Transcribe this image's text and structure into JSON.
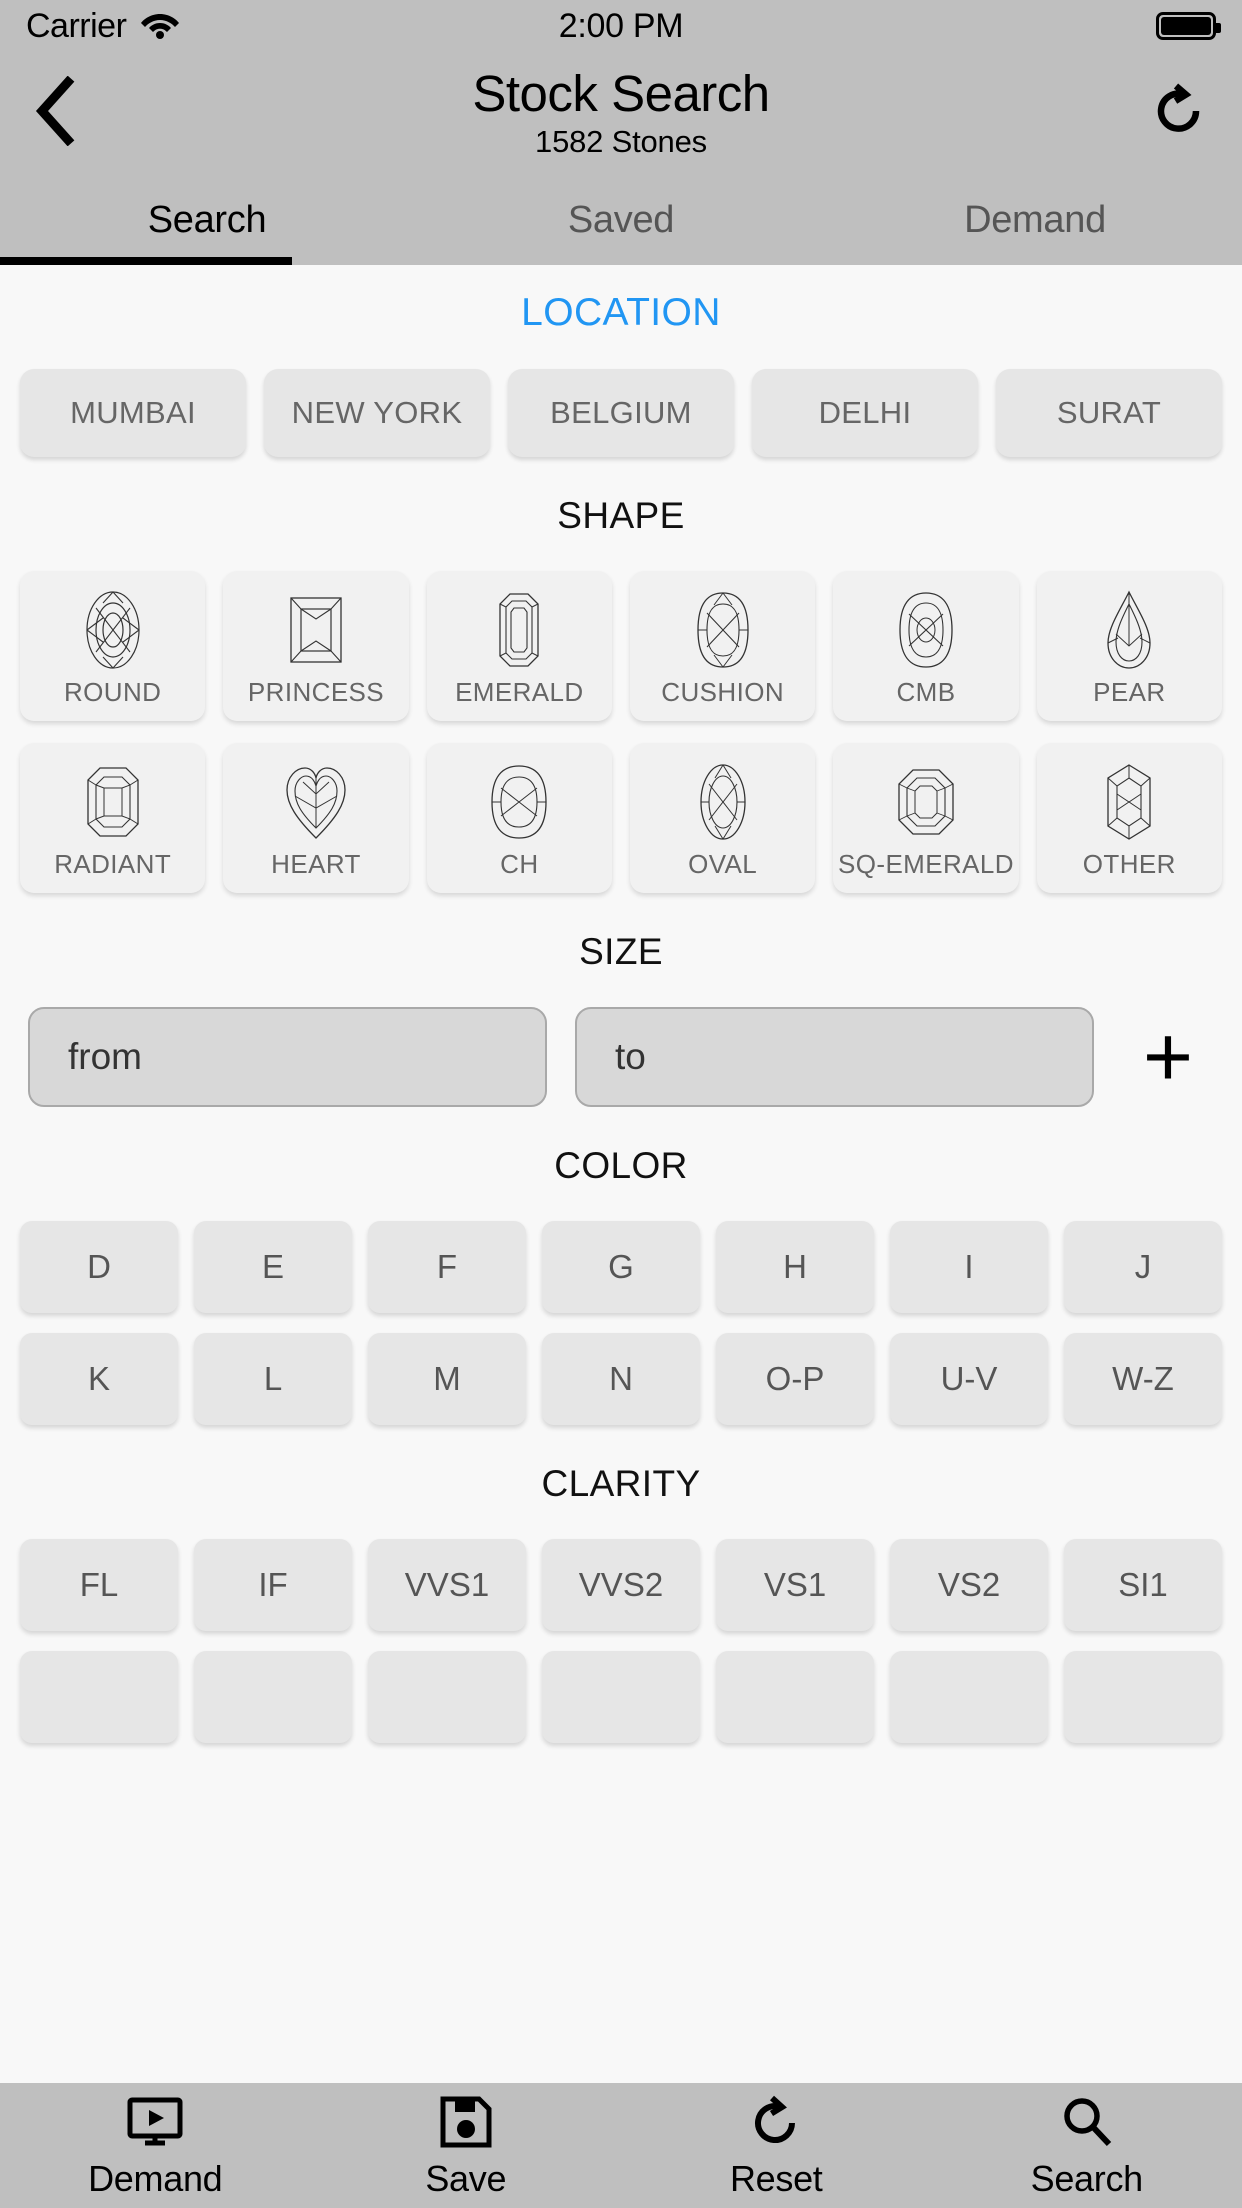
{
  "status_bar": {
    "carrier": "Carrier",
    "wifi_icon": "wifi-icon",
    "time": "2:00 PM",
    "battery_icon": "battery-full-icon"
  },
  "nav_bar": {
    "back_icon": "chevron-left-icon",
    "title": "Stock Search",
    "subtitle": "1582 Stones",
    "refresh_icon": "refresh-icon"
  },
  "tabs": {
    "items": [
      {
        "label": "Search",
        "active": true
      },
      {
        "label": "Saved",
        "active": false
      },
      {
        "label": "Demand",
        "active": false
      }
    ]
  },
  "sections": {
    "location": {
      "title": "LOCATION",
      "accent_color": "#2196f3",
      "options": [
        "MUMBAI",
        "NEW YORK",
        "BELGIUM",
        "DELHI",
        "SURAT"
      ]
    },
    "shape": {
      "title": "SHAPE",
      "rows": [
        [
          {
            "label": "ROUND",
            "icon": "diamond-round-icon"
          },
          {
            "label": "PRINCESS",
            "icon": "diamond-princess-icon"
          },
          {
            "label": "EMERALD",
            "icon": "diamond-emerald-icon"
          },
          {
            "label": "CUSHION",
            "icon": "diamond-cushion-icon"
          },
          {
            "label": "CMB",
            "icon": "diamond-cmb-icon"
          },
          {
            "label": "PEAR",
            "icon": "diamond-pear-icon"
          }
        ],
        [
          {
            "label": "RADIANT",
            "icon": "diamond-radiant-icon"
          },
          {
            "label": "HEART",
            "icon": "diamond-heart-icon"
          },
          {
            "label": "CH",
            "icon": "diamond-ch-icon"
          },
          {
            "label": "OVAL",
            "icon": "diamond-oval-icon"
          },
          {
            "label": "SQ-EMERALD",
            "icon": "diamond-sq-emerald-icon"
          },
          {
            "label": "OTHER",
            "icon": "diamond-other-icon"
          }
        ]
      ]
    },
    "size": {
      "title": "SIZE",
      "from_placeholder": "from",
      "from_value": "",
      "to_placeholder": "to",
      "to_value": "",
      "add_label": "+"
    },
    "color": {
      "title": "COLOR",
      "rows": [
        [
          "D",
          "E",
          "F",
          "G",
          "H",
          "I",
          "J"
        ],
        [
          "K",
          "L",
          "M",
          "N",
          "O-P",
          "U-V",
          "W-Z"
        ]
      ]
    },
    "clarity": {
      "title": "CLARITY",
      "rows": [
        [
          "FL",
          "IF",
          "VVS1",
          "VVS2",
          "VS1",
          "VS2",
          "SI1"
        ]
      ]
    }
  },
  "bottom_bar": {
    "items": [
      {
        "label": "Demand",
        "icon": "demand-monitor-icon"
      },
      {
        "label": "Save",
        "icon": "save-floppy-icon"
      },
      {
        "label": "Reset",
        "icon": "reset-refresh-icon"
      },
      {
        "label": "Search",
        "icon": "search-magnifier-icon"
      }
    ]
  }
}
